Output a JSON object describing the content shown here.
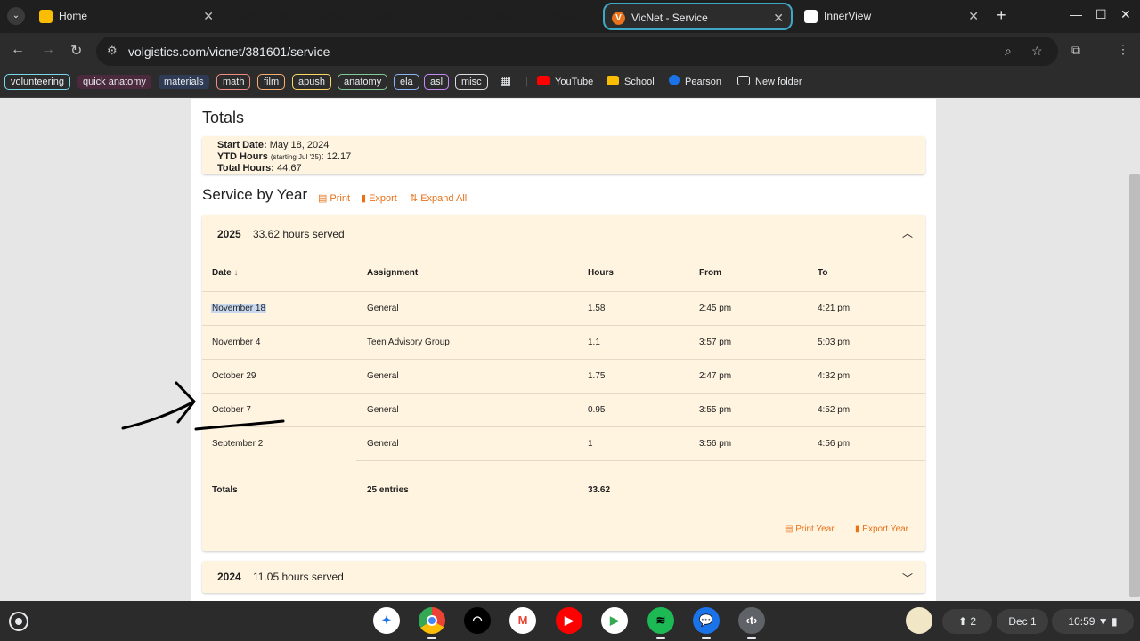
{
  "tabs": {
    "home_label": "Home",
    "groups": [
      {
        "label": "math",
        "color": "#f28b82"
      },
      {
        "label": "film",
        "color": "#fcad70"
      },
      {
        "label": "apush",
        "color": "#fdd663"
      },
      {
        "label": "anatomy",
        "color": "#81c995"
      },
      {
        "label": "ela",
        "color": "#8ab4f8"
      },
      {
        "label": "asl",
        "color": "#c58af9"
      },
      {
        "label": "misc",
        "color": "#dadce0"
      },
      {
        "label": "volunteering",
        "color": "#78d9ec"
      }
    ],
    "active_label": "VicNet - Service",
    "active_icon_letter": "V",
    "innerview_label": "InnerView"
  },
  "toolbar": {
    "url": "volgistics.com/vicnet/381601/service"
  },
  "bookmarks": {
    "chips": [
      {
        "label": "volunteering",
        "color": "#78d9ec"
      },
      {
        "label": "quick anatomy",
        "color": "#ff8bcb"
      },
      {
        "label": "materials",
        "color": "#8ab4f8"
      },
      {
        "label": "math",
        "color": "#f28b82"
      },
      {
        "label": "film",
        "color": "#fcad70"
      },
      {
        "label": "apush",
        "color": "#fdd663"
      },
      {
        "label": "anatomy",
        "color": "#81c995"
      },
      {
        "label": "ela",
        "color": "#8ab4f8"
      },
      {
        "label": "asl",
        "color": "#c58af9"
      },
      {
        "label": "misc",
        "color": "#dadce0"
      }
    ],
    "youtube": "YouTube",
    "school": "School",
    "pearson": "Pearson",
    "new_folder": "New folder"
  },
  "page": {
    "totals_heading": "Totals",
    "start_date_label": "Start Date:",
    "start_date_value": "May 18, 2024",
    "ytd_label": "YTD Hours",
    "ytd_note": "(starting Jul '25)",
    "ytd_value": ": 12.17",
    "total_label": "Total Hours:",
    "total_value": "44.67",
    "service_heading": "Service by Year",
    "print_label": "Print",
    "export_label": "Export",
    "expand_label": "Expand All",
    "year1": {
      "year": "2025",
      "hours": "33.62 hours served",
      "columns": {
        "date": "Date",
        "assignment": "Assignment",
        "hours": "Hours",
        "from": "From",
        "to": "To"
      },
      "rows": [
        {
          "date": "November 18",
          "assignment": "General",
          "hours": "1.58",
          "from": "2:45 pm",
          "to": "4:21 pm"
        },
        {
          "date": "November 4",
          "assignment": "Teen Advisory Group",
          "hours": "1.1",
          "from": "3:57 pm",
          "to": "5:03 pm"
        },
        {
          "date": "October 29",
          "assignment": "General",
          "hours": "1.75",
          "from": "2:47 pm",
          "to": "4:32 pm"
        },
        {
          "date": "October 7",
          "assignment": "General",
          "hours": "0.95",
          "from": "3:55 pm",
          "to": "4:52 pm"
        },
        {
          "date": "September 2",
          "assignment": "General",
          "hours": "1",
          "from": "3:56 pm",
          "to": "4:56 pm"
        }
      ],
      "totals": {
        "label": "Totals",
        "entries": "25 entries",
        "hours": "33.62"
      },
      "print_year": "Print Year",
      "export_year": "Export Year"
    },
    "year2": {
      "year": "2024",
      "hours": "11.05 hours served"
    }
  },
  "shelf": {
    "notif_count": "2",
    "date": "Dec 1",
    "time": "10:59"
  }
}
